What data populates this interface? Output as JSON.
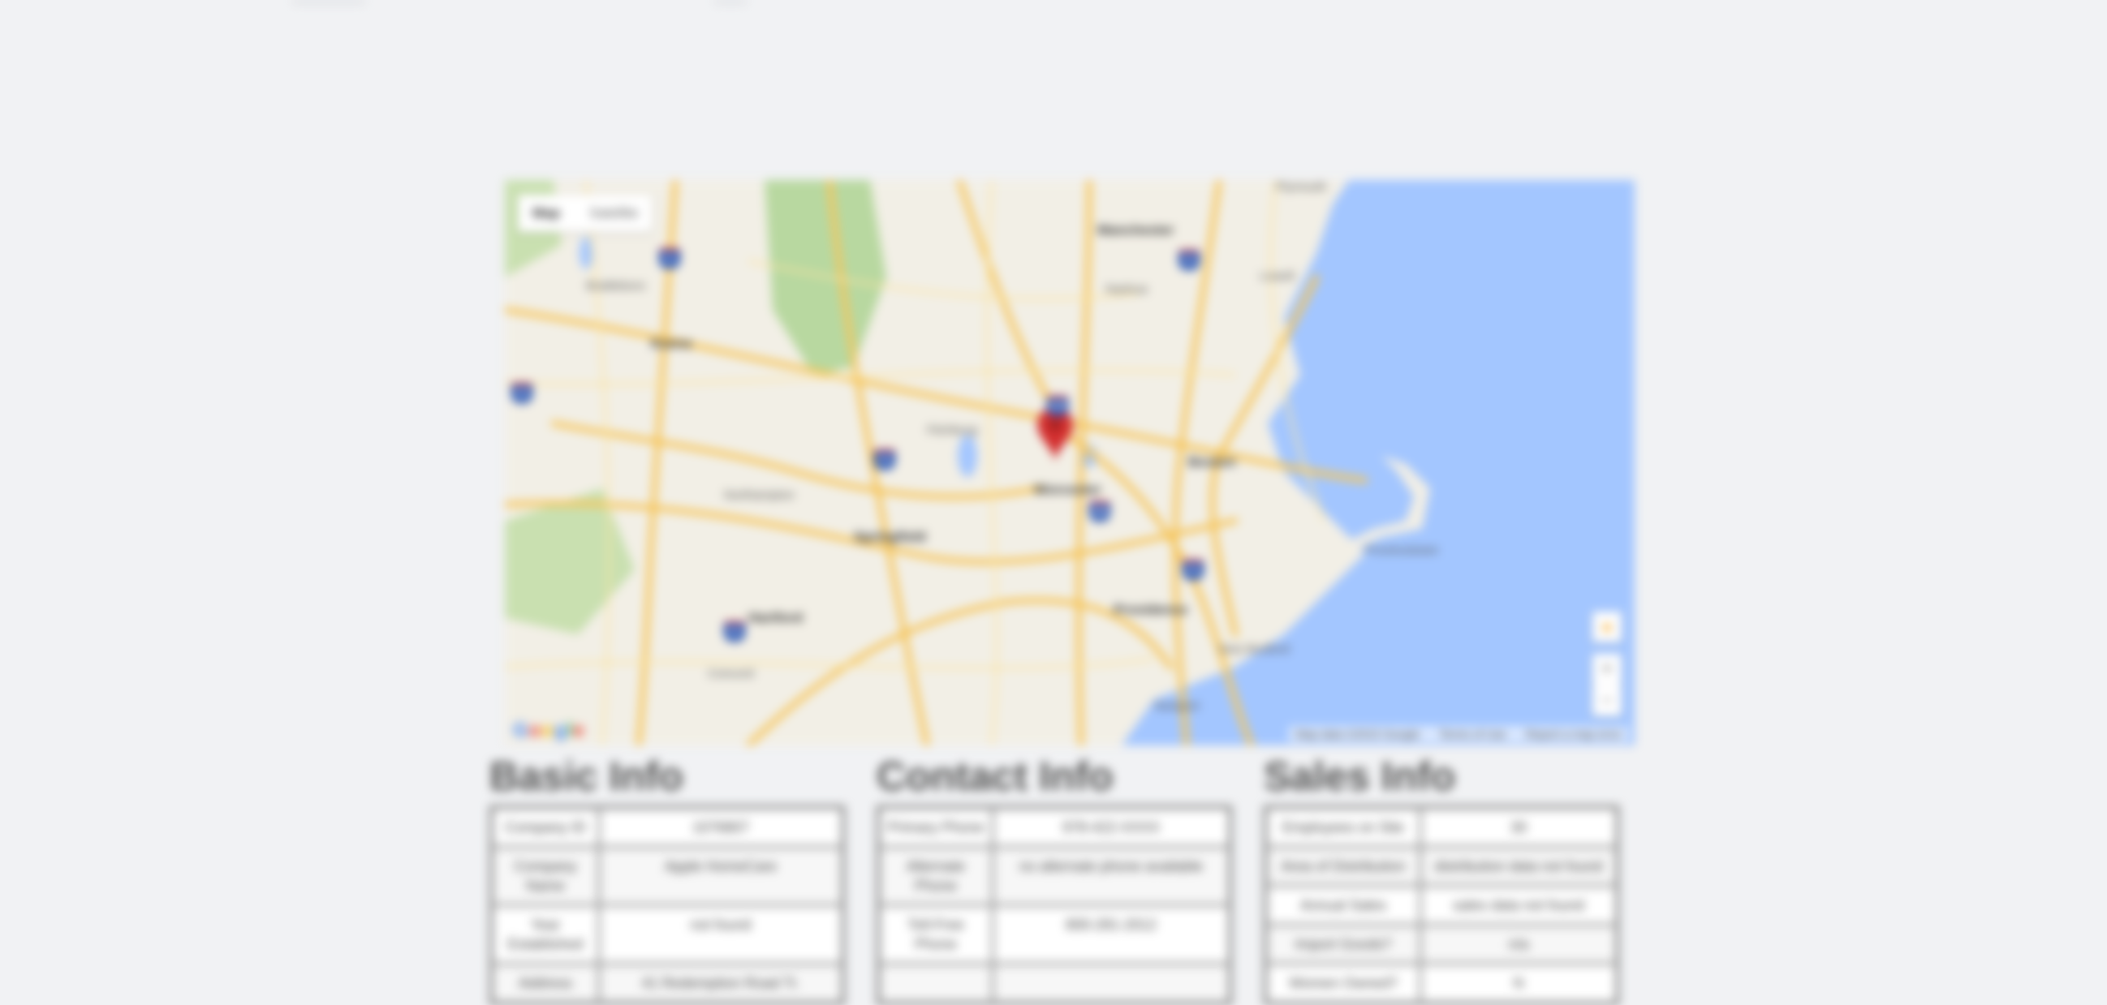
{
  "map": {
    "type_controls": [
      {
        "label": "Map",
        "active": true
      },
      {
        "label": "Satellite",
        "active": false
      }
    ],
    "zoom_in_label": "+",
    "zoom_out_label": "−",
    "attribution": "Map data ©2015 Google",
    "terms_label": "Terms of Use",
    "report_label": "Report a map error",
    "logo_text": "Google",
    "place_labels": [
      "Boston",
      "Worcester",
      "Providence",
      "Springfield",
      "Hartford",
      "Manchester",
      "Nashua",
      "Lowell",
      "Keene",
      "Brattleboro",
      "Northampton",
      "Fitchburg",
      "Plymouth",
      "Provincetown",
      "New Bedford",
      "Newport",
      "Concord"
    ],
    "marker_color": "#d32f2f",
    "water_color": "#a3c6ff",
    "road_color": "#f6c55a"
  },
  "sections": {
    "basic": {
      "title": "Basic Info",
      "rows": [
        {
          "label": "Company ID",
          "value": "1076807"
        },
        {
          "label": "Company Name",
          "value": "Apple HomeCare"
        },
        {
          "label": "Year Established",
          "value": "not found"
        },
        {
          "label": "Address",
          "value": "41 Redemption Road Tr."
        }
      ]
    },
    "contact": {
      "title": "Contact Info",
      "rows": [
        {
          "label": "Primary Phone",
          "value": "978-422-XXXX"
        },
        {
          "label": "Alternate Phone",
          "value": "no alternate phone available"
        },
        {
          "label": "Toll-Free Phone",
          "value": "800-281-2012"
        },
        {
          "label": "",
          "value": ""
        }
      ]
    },
    "sales": {
      "title": "Sales Info",
      "rows": [
        {
          "label": "Employees on Site",
          "value": "30"
        },
        {
          "label": "Area of Distribution",
          "value": "distribution data not found"
        },
        {
          "label": "Annual Sales",
          "value": "sales data not found"
        },
        {
          "label": "Import Goods?",
          "value": "n/a"
        },
        {
          "label": "Women Owned?",
          "value": "N"
        }
      ]
    }
  }
}
